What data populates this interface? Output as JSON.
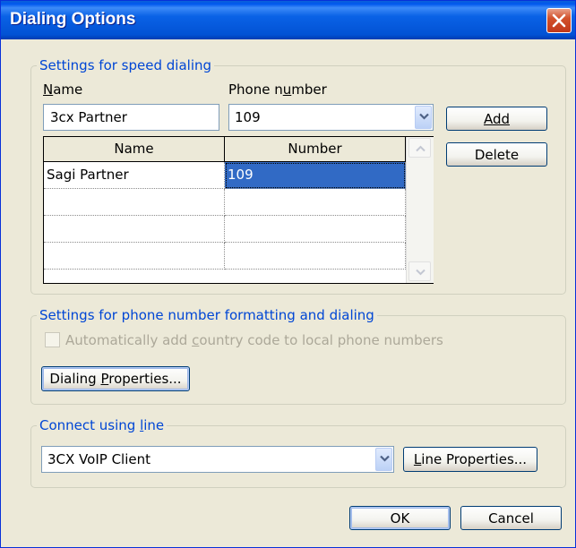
{
  "window": {
    "title": "Dialing Options"
  },
  "speed_dialing": {
    "legend": "Settings for speed dialing",
    "name_label": "Name",
    "name_value": "3cx Partner",
    "phone_label": "Phone number",
    "phone_value": "109",
    "add_label": "Add",
    "delete_label": "Delete",
    "columns": [
      "Name",
      "Number"
    ],
    "rows": [
      {
        "name": "Sagi Partner",
        "number": "109",
        "selected": true
      }
    ]
  },
  "formatting": {
    "legend": "Settings for phone number formatting and dialing",
    "checkbox_label": "Automatically add country code to local phone numbers",
    "checkbox_checked": false,
    "checkbox_enabled": false,
    "dialing_properties_label": "Dialing Properties..."
  },
  "connect": {
    "legend": "Connect using line",
    "line_value": "3CX VoIP Client",
    "line_properties_label": "Line Properties..."
  },
  "footer": {
    "ok_label": "OK",
    "cancel_label": "Cancel"
  },
  "colors": {
    "title_bar": "#0058ee",
    "legend_text": "#0046d5",
    "selection": "#316ac5",
    "close_button": "#d2512b"
  }
}
